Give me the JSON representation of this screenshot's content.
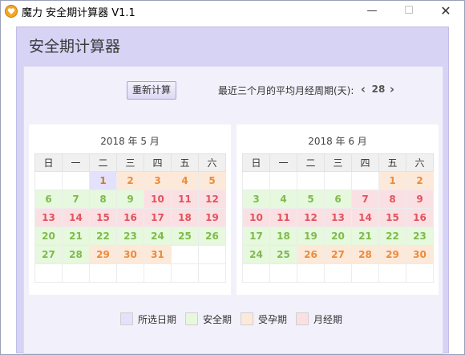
{
  "window": {
    "title": "魔力 安全期计算器 V1.1",
    "controls": {
      "minimize": "—",
      "maximize": "☐",
      "close": "✕"
    }
  },
  "header": {
    "title": "安全期计算器"
  },
  "toolbar": {
    "recalc_label": "重新计算",
    "cycle_label": "最近三个月的平均月经周期(天):",
    "cycle_value": "28",
    "prev_glyph": "‹",
    "next_glyph": "›"
  },
  "weekdays": [
    "日",
    "一",
    "二",
    "三",
    "四",
    "五",
    "六"
  ],
  "colors": {
    "selected_bg": "#e3e1fb",
    "safe_bg": "#e6f8dd",
    "safe_text": "#7fba4d",
    "ovulation_bg": "#fde9d9",
    "ovulation_text": "#ec8b3c",
    "period_bg": "#fbe0e3",
    "period_text": "#e0545d"
  },
  "calendars": [
    {
      "title": "2018 年  5 月",
      "weeks": [
        [
          {
            "d": ""
          },
          {
            "d": ""
          },
          {
            "d": "1",
            "t": "sel"
          },
          {
            "d": "2",
            "t": "ov"
          },
          {
            "d": "3",
            "t": "ov"
          },
          {
            "d": "4",
            "t": "ov"
          },
          {
            "d": "5",
            "t": "ov"
          }
        ],
        [
          {
            "d": "6",
            "t": "safe"
          },
          {
            "d": "7",
            "t": "safe"
          },
          {
            "d": "8",
            "t": "safe"
          },
          {
            "d": "9",
            "t": "safe"
          },
          {
            "d": "10",
            "t": "per"
          },
          {
            "d": "11",
            "t": "per"
          },
          {
            "d": "12",
            "t": "per"
          }
        ],
        [
          {
            "d": "13",
            "t": "per"
          },
          {
            "d": "14",
            "t": "per"
          },
          {
            "d": "15",
            "t": "per"
          },
          {
            "d": "16",
            "t": "per"
          },
          {
            "d": "17",
            "t": "per"
          },
          {
            "d": "18",
            "t": "per"
          },
          {
            "d": "19",
            "t": "per"
          }
        ],
        [
          {
            "d": "20",
            "t": "safe"
          },
          {
            "d": "21",
            "t": "safe"
          },
          {
            "d": "22",
            "t": "safe"
          },
          {
            "d": "23",
            "t": "safe"
          },
          {
            "d": "24",
            "t": "safe"
          },
          {
            "d": "25",
            "t": "safe"
          },
          {
            "d": "26",
            "t": "safe"
          }
        ],
        [
          {
            "d": "27",
            "t": "safe"
          },
          {
            "d": "28",
            "t": "safe"
          },
          {
            "d": "29",
            "t": "ov"
          },
          {
            "d": "30",
            "t": "ov"
          },
          {
            "d": "31",
            "t": "ov"
          },
          {
            "d": ""
          },
          {
            "d": ""
          }
        ],
        [
          {
            "d": ""
          },
          {
            "d": ""
          },
          {
            "d": ""
          },
          {
            "d": ""
          },
          {
            "d": ""
          },
          {
            "d": ""
          },
          {
            "d": ""
          }
        ]
      ]
    },
    {
      "title": "2018 年  6 月",
      "weeks": [
        [
          {
            "d": ""
          },
          {
            "d": ""
          },
          {
            "d": ""
          },
          {
            "d": ""
          },
          {
            "d": ""
          },
          {
            "d": "1",
            "t": "ov"
          },
          {
            "d": "2",
            "t": "ov"
          }
        ],
        [
          {
            "d": "3",
            "t": "safe"
          },
          {
            "d": "4",
            "t": "safe"
          },
          {
            "d": "5",
            "t": "safe"
          },
          {
            "d": "6",
            "t": "safe"
          },
          {
            "d": "7",
            "t": "per"
          },
          {
            "d": "8",
            "t": "per"
          },
          {
            "d": "9",
            "t": "per"
          }
        ],
        [
          {
            "d": "10",
            "t": "per"
          },
          {
            "d": "11",
            "t": "per"
          },
          {
            "d": "12",
            "t": "per"
          },
          {
            "d": "13",
            "t": "per"
          },
          {
            "d": "14",
            "t": "per"
          },
          {
            "d": "15",
            "t": "per"
          },
          {
            "d": "16",
            "t": "per"
          }
        ],
        [
          {
            "d": "17",
            "t": "safe"
          },
          {
            "d": "18",
            "t": "safe"
          },
          {
            "d": "19",
            "t": "safe"
          },
          {
            "d": "20",
            "t": "safe"
          },
          {
            "d": "21",
            "t": "safe"
          },
          {
            "d": "22",
            "t": "safe"
          },
          {
            "d": "23",
            "t": "safe"
          }
        ],
        [
          {
            "d": "24",
            "t": "safe"
          },
          {
            "d": "25",
            "t": "safe"
          },
          {
            "d": "26",
            "t": "ov"
          },
          {
            "d": "27",
            "t": "ov"
          },
          {
            "d": "28",
            "t": "ov"
          },
          {
            "d": "29",
            "t": "ov"
          },
          {
            "d": "30",
            "t": "ov"
          }
        ],
        [
          {
            "d": ""
          },
          {
            "d": ""
          },
          {
            "d": ""
          },
          {
            "d": ""
          },
          {
            "d": ""
          },
          {
            "d": ""
          },
          {
            "d": ""
          }
        ]
      ]
    }
  ],
  "legend": {
    "selected": "所选日期",
    "safe": "安全期",
    "ovulation": "受孕期",
    "period": "月经期"
  }
}
